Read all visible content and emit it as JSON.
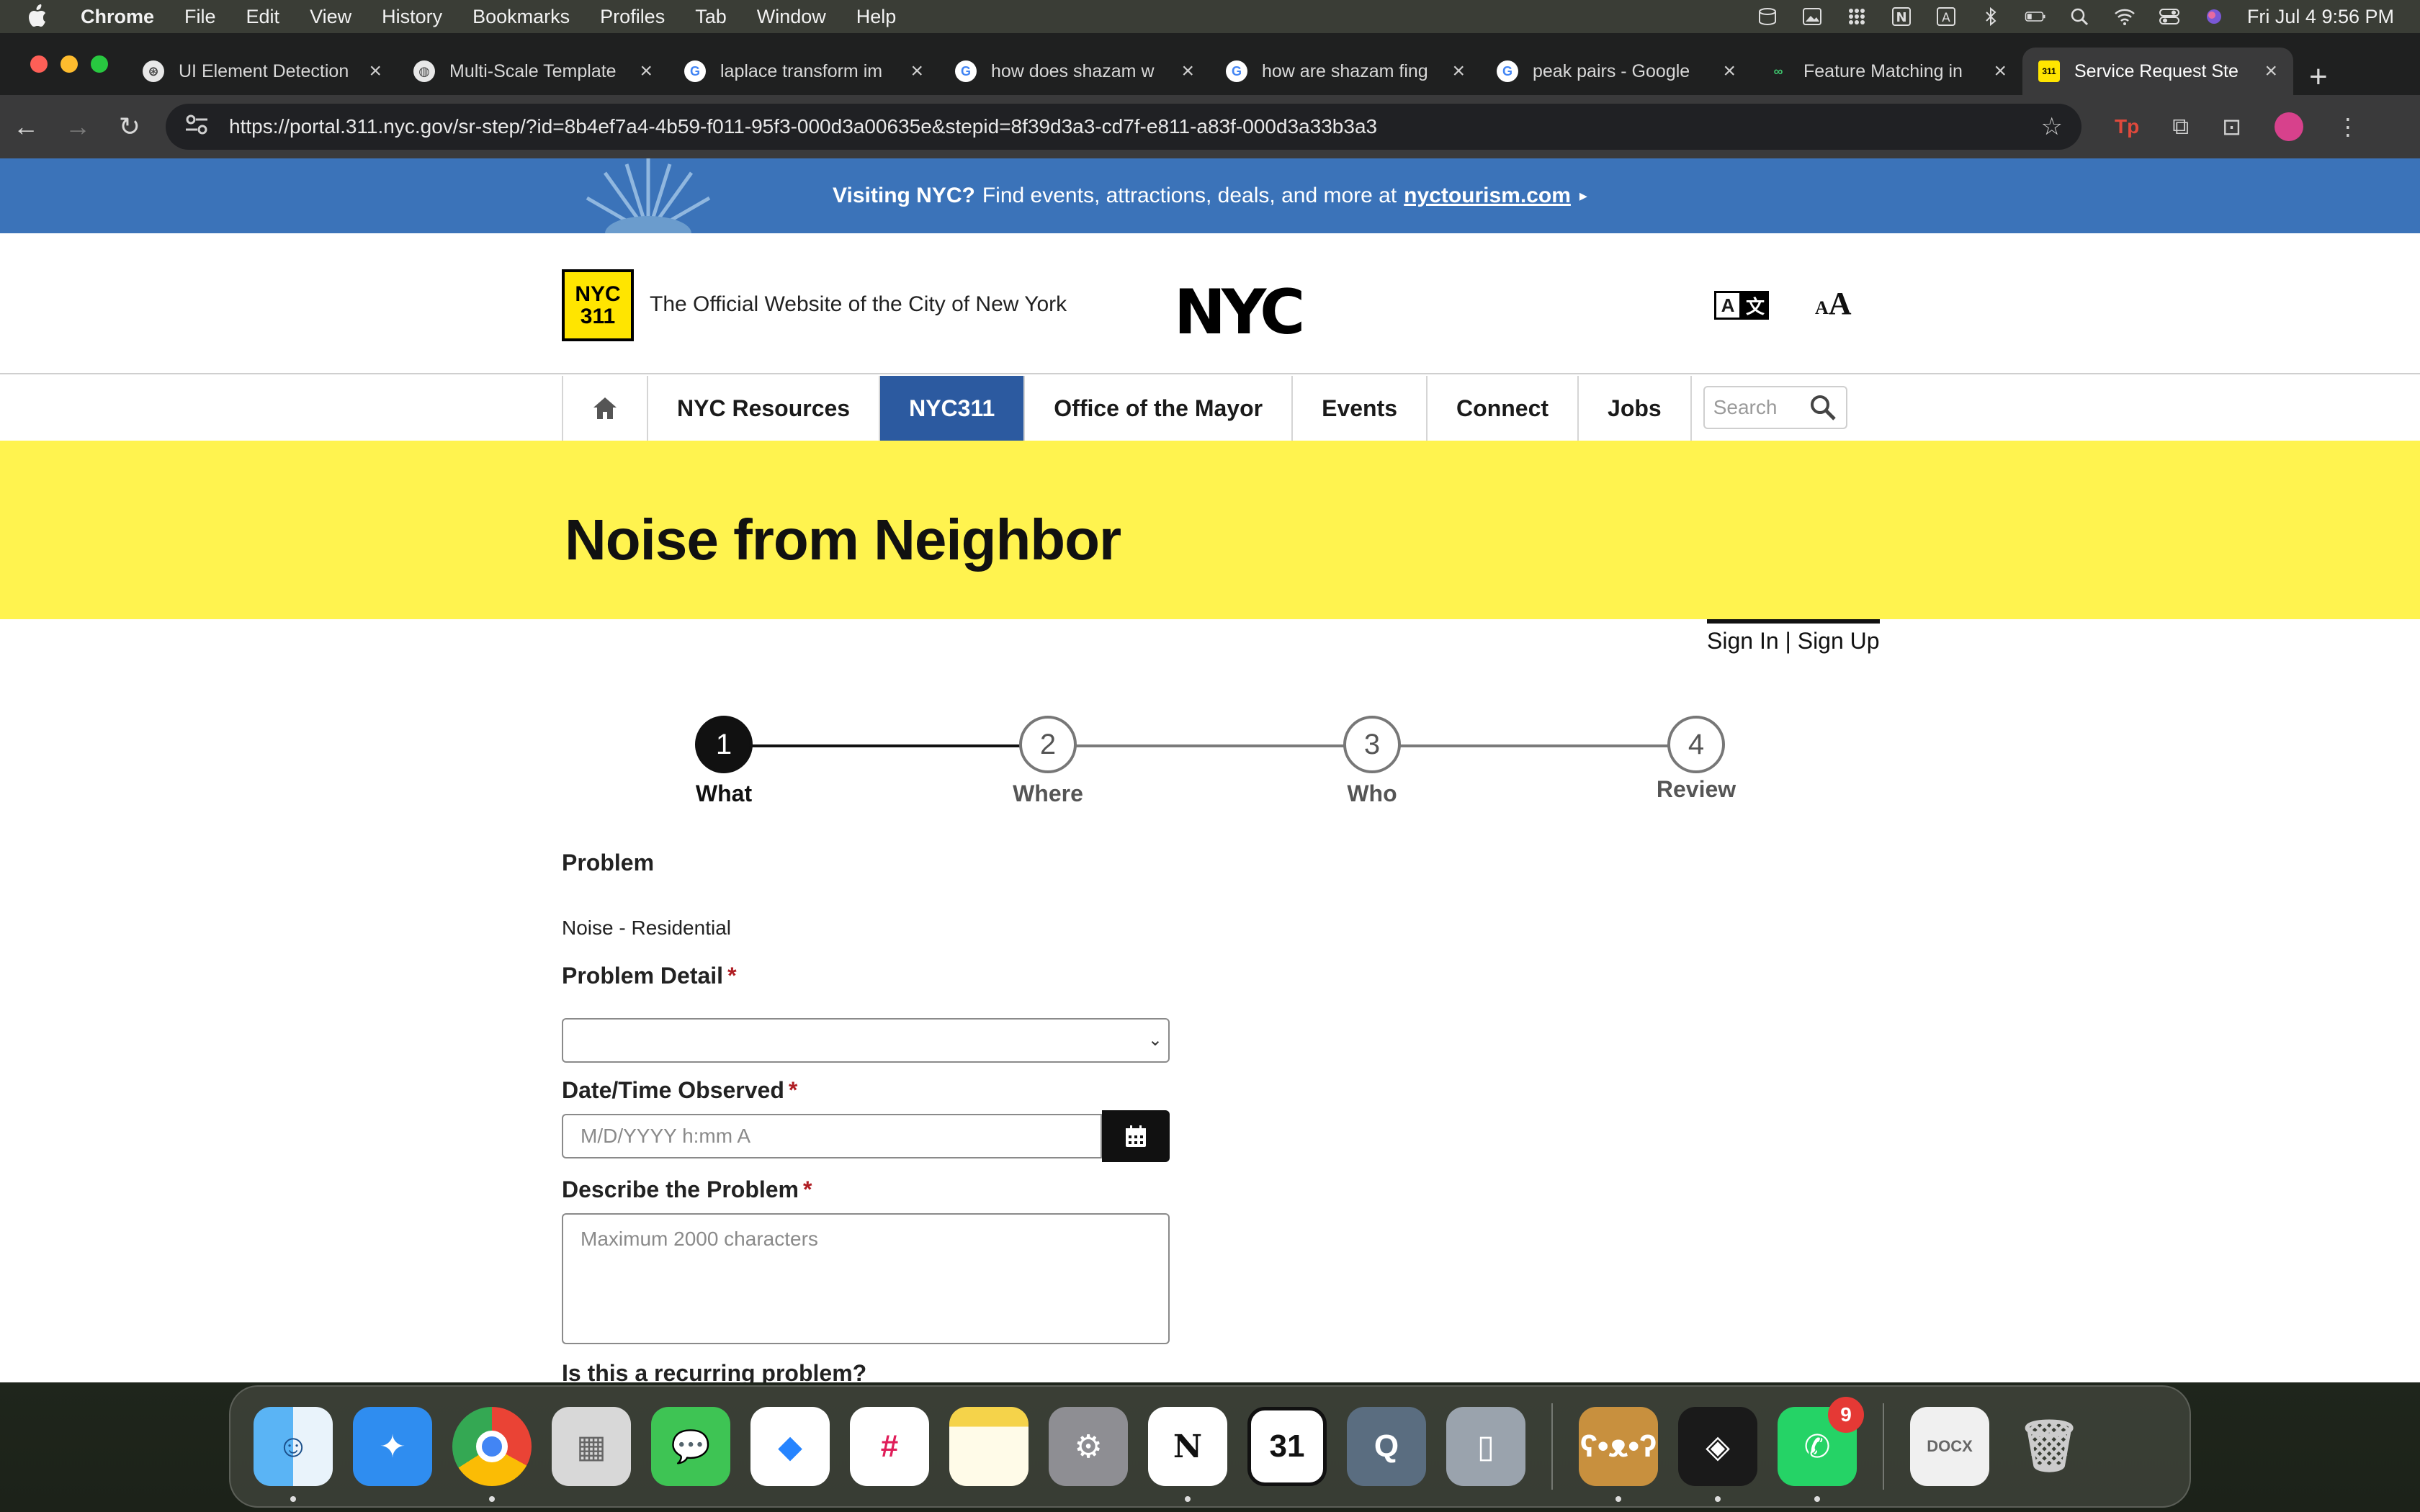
{
  "menubar": {
    "app_name": "Chrome",
    "items": [
      "File",
      "Edit",
      "View",
      "History",
      "Bookmarks",
      "Profiles",
      "Tab",
      "Window",
      "Help"
    ],
    "clock": "Fri Jul 4  9:56 PM"
  },
  "tabs": [
    {
      "title": "UI Element Detection",
      "favicon": "openai-icon"
    },
    {
      "title": "Multi-Scale Template",
      "favicon": "globe-icon"
    },
    {
      "title": "laplace transform im",
      "favicon": "google-icon"
    },
    {
      "title": "how does shazam w",
      "favicon": "google-icon"
    },
    {
      "title": "how are shazam fing",
      "favicon": "google-icon"
    },
    {
      "title": "peak pairs - Google",
      "favicon": "google-icon"
    },
    {
      "title": "Feature Matching in",
      "favicon": "opencv-icon"
    },
    {
      "title": "Service Request Ste",
      "favicon": "nyc311-icon",
      "active": true
    }
  ],
  "toolbar": {
    "url": "https://portal.311.nyc.gov/sr-step/?id=8b4ef7a4-4b59-f011-95f3-000d3a00635e&stepid=8f39d3a3-cd7f-e811-a83f-000d3a33b3a3"
  },
  "promo": {
    "bold": "Visiting NYC?",
    "text": "Find events, attractions, deals, and more at",
    "link": "nyctourism.com",
    "arrow": "▸"
  },
  "header": {
    "logo_top": "NYC",
    "logo_bottom": "311",
    "tagline": "The Official Website of the City of New York",
    "city_logo": "NYC",
    "translate_a": "A",
    "translate_b": "文",
    "textsize_small": "A",
    "textsize_large": "A"
  },
  "nav": {
    "items": [
      "NYC Resources",
      "NYC311",
      "Office of the Mayor",
      "Events",
      "Connect",
      "Jobs"
    ],
    "active": "NYC311",
    "search_placeholder": "Search"
  },
  "page": {
    "title": "Noise from Neighbor",
    "sign_in": "Sign In",
    "separator": "|",
    "sign_up": "Sign Up"
  },
  "stepper": [
    {
      "number": "1",
      "label": "What",
      "active": true
    },
    {
      "number": "2",
      "label": "Where"
    },
    {
      "number": "3",
      "label": "Who"
    },
    {
      "number": "4",
      "label": "Review"
    }
  ],
  "form": {
    "problem_label": "Problem",
    "problem_value": "Noise - Residential",
    "detail_label": "Problem Detail",
    "detail_value": "",
    "datetime_label": "Date/Time Observed",
    "datetime_placeholder": "M/D/YYYY h:mm A",
    "describe_label": "Describe the Problem",
    "describe_placeholder": "Maximum 2000 characters",
    "recurring_label": "Is this a recurring problem?",
    "required_mark": "*"
  },
  "dock": {
    "apps": [
      "Finder",
      "Safari",
      "Chrome",
      "Launchpad",
      "Messages",
      "Jira",
      "Slack",
      "Notes",
      "System Settings",
      "Notion",
      "Notion Calendar",
      "QuickTime",
      "iPhone Mirroring",
      "Bear",
      "Perplexity",
      "WhatsApp",
      "Document",
      "Trash"
    ],
    "whatsapp_badge": "9",
    "calendar_day": "31"
  },
  "colors": {
    "nav_active": "#2c5aa0",
    "banner_yellow": "#fff34f",
    "promo_blue": "#3b73b9",
    "required_red": "#b01e24"
  }
}
